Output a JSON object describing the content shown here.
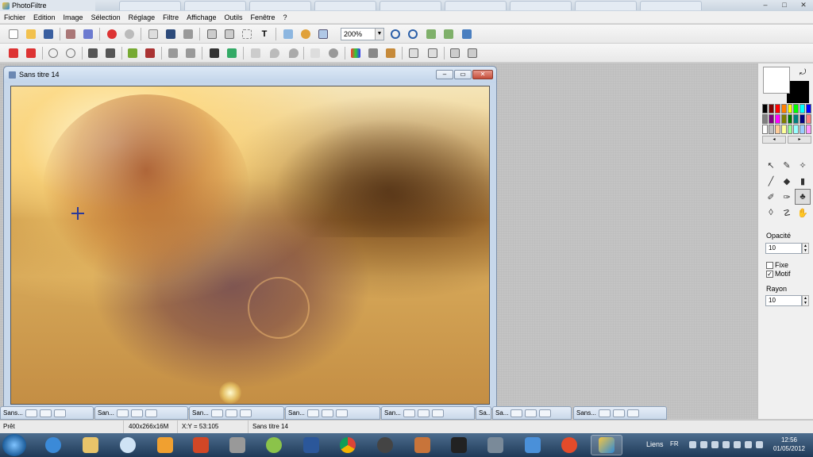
{
  "app": {
    "title": "PhotoFiltre"
  },
  "menu": [
    "Fichier",
    "Edition",
    "Image",
    "Sélection",
    "Réglage",
    "Filtre",
    "Affichage",
    "Outils",
    "Fenêtre",
    "?"
  ],
  "toolbar": {
    "zoom_value": "200%"
  },
  "document": {
    "title": "Sans titre 14"
  },
  "minimized_windows": [
    {
      "label": "Sans..."
    },
    {
      "label": "San..."
    },
    {
      "label": "San..."
    },
    {
      "label": "San..."
    },
    {
      "label": "San..."
    },
    {
      "label": "Sa..."
    },
    {
      "label": "Sa..."
    },
    {
      "label": "Sans..."
    }
  ],
  "panel": {
    "opacity_label": "Opacité",
    "opacity_value": "10",
    "fixe_label": "Fixe",
    "fixe_checked": false,
    "motif_label": "Motif",
    "motif_checked": true,
    "rayon_label": "Rayon",
    "rayon_value": "10",
    "foreground_color": "#ffffff",
    "background_color": "#000000",
    "palette": [
      "#000000",
      "#7f0000",
      "#ff0000",
      "#ff7f00",
      "#ffff00",
      "#00ff00",
      "#00ffff",
      "#0000ff",
      "#7f7f7f",
      "#7f007f",
      "#ff00ff",
      "#7f7f00",
      "#007f00",
      "#007f7f",
      "#00007f",
      "#ff7f7f",
      "#ffffff",
      "#c0c0c0",
      "#ffcc99",
      "#ffff99",
      "#99ff99",
      "#99ffff",
      "#99ccff",
      "#ff99ff"
    ]
  },
  "status": {
    "state": "Prêt",
    "image_info": "400x266x16M",
    "coords": "X:Y = 53:105",
    "doc_name": "Sans titre 14"
  },
  "taskbar": {
    "liens": "Liens",
    "lang": "FR",
    "time": "12:56",
    "date": "01/05/2012"
  }
}
